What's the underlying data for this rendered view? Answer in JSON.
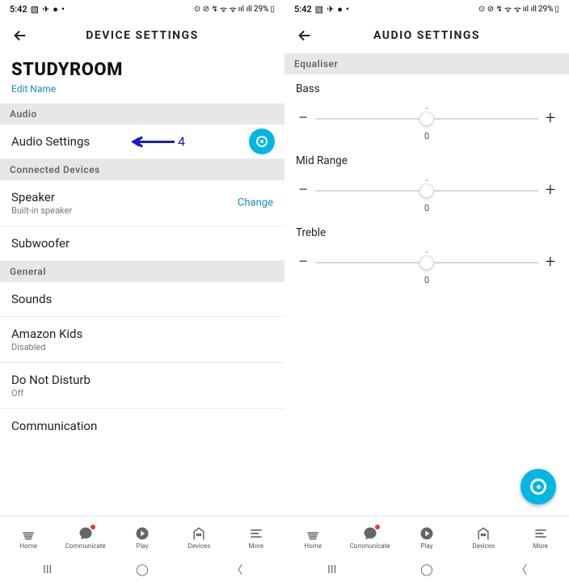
{
  "status": {
    "time": "5:42",
    "battery": "29%"
  },
  "left": {
    "title": "DEVICE SETTINGS",
    "deviceName": "STUDYROOM",
    "editName": "Edit Name",
    "audioHeader": "Audio",
    "audioSettings": "Audio Settings",
    "annotNum": "4",
    "connectedHeader": "Connected Devices",
    "speaker": "Speaker",
    "speakerSub": "Built-in speaker",
    "change": "Change",
    "subwoofer": "Subwoofer",
    "generalHeader": "General",
    "sounds": "Sounds",
    "amazonKids": "Amazon Kids",
    "amazonKidsSub": "Disabled",
    "dnd": "Do Not Disturb",
    "dndSub": "Off",
    "communication": "Communication"
  },
  "right": {
    "title": "AUDIO SETTINGS",
    "eqHeader": "Equaliser",
    "bass": {
      "label": "Bass",
      "value": "0"
    },
    "mid": {
      "label": "Mid Range",
      "value": "0"
    },
    "treble": {
      "label": "Treble",
      "value": "0"
    }
  },
  "nav": {
    "home": "Home",
    "communicate": "Communicate",
    "play": "Play",
    "devices": "Devices",
    "more": "More"
  }
}
